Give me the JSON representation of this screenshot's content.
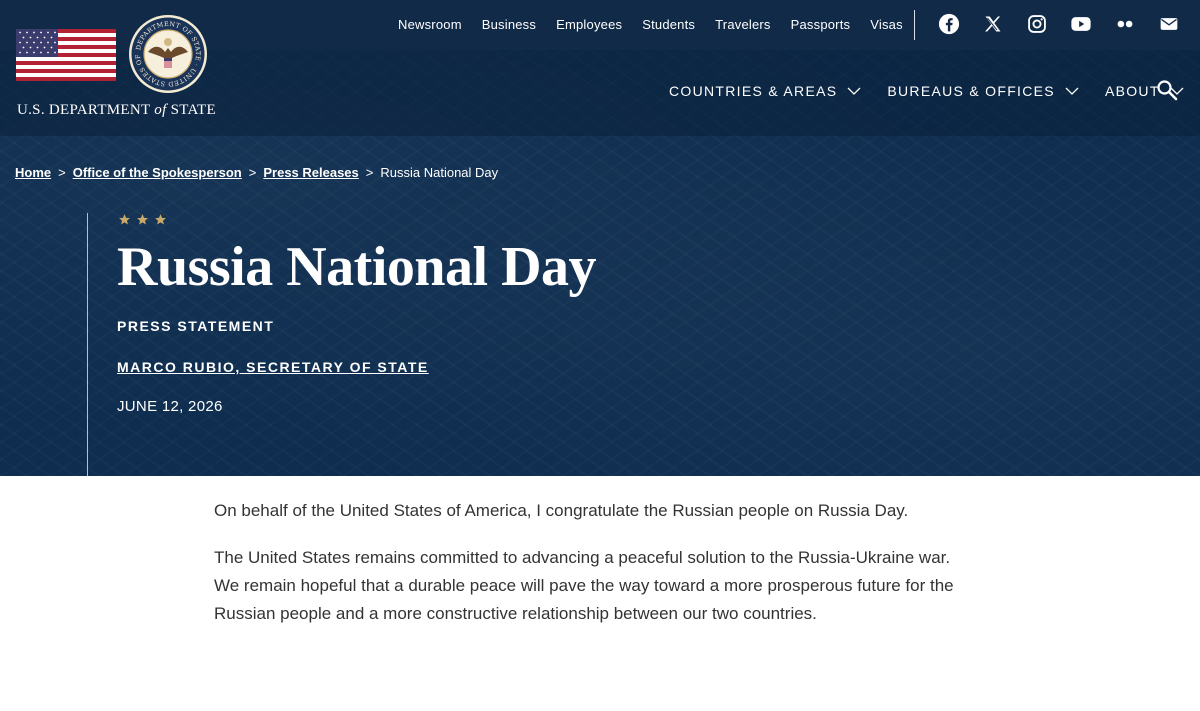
{
  "utility_nav": [
    "Newsroom",
    "Business",
    "Employees",
    "Students",
    "Travelers",
    "Passports",
    "Visas"
  ],
  "social": [
    "facebook-icon",
    "x-icon",
    "instagram-icon",
    "youtube-icon",
    "flickr-icon",
    "email-icon"
  ],
  "brand": {
    "prefix": "U.S. DEPARTMENT",
    "connector": "of",
    "suffix": "STATE",
    "seal_text": "DEPARTMENT OF STATE · UNITED STATES OF AMERICA"
  },
  "main_nav": {
    "countries": "COUNTRIES & AREAS",
    "bureaus": "BUREAUS & OFFICES",
    "about": "ABOUT"
  },
  "breadcrumb": {
    "home": "Home",
    "spokesperson": "Office of the Spokesperson",
    "press_releases": "Press Releases",
    "current": "Russia National Day",
    "separator": ">"
  },
  "article": {
    "title": "Russia National Day",
    "type": "PRESS STATEMENT",
    "author": "MARCO RUBIO, SECRETARY OF STATE",
    "date": "JUNE 12, 2026",
    "paragraphs": [
      "On behalf of the United States of America, I congratulate the Russian people on Russia Day.",
      "The United States remains committed to advancing a peaceful solution to the Russia-Ukraine war. We remain hopeful that a durable peace will pave the way toward a more prosperous future for the Russian people and a more constructive relationship between our two countries."
    ]
  },
  "colors": {
    "navy": "#0e2d4f",
    "topbar": "#102a47",
    "gold": "#c8a96a",
    "text": "#333333"
  }
}
